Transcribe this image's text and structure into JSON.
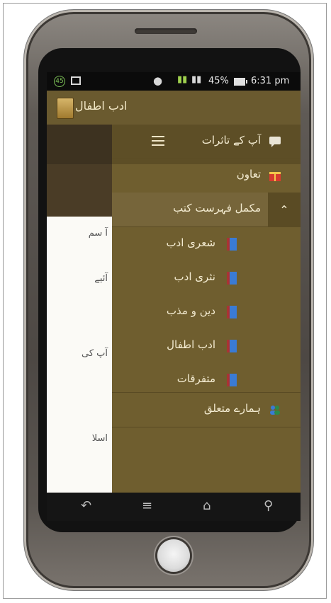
{
  "status_bar": {
    "badge": "45",
    "battery_pct": "45%",
    "time": "6:31 pm"
  },
  "app_bar": {
    "title": "ادب اطفال"
  },
  "behind_list": [
    "آ سم",
    "آئیے",
    "آپ کی",
    "اسلا"
  ],
  "drawer": {
    "items": [
      {
        "label": "آپ کے تاثرات",
        "icon": "comment-icon"
      },
      {
        "label": "تعاون",
        "icon": "gift-icon"
      },
      {
        "label": "مکمل فہرست کتب",
        "icon": "clipboard-icon"
      },
      {
        "label": "ہمارے متعلق",
        "icon": "people-icon"
      }
    ],
    "sub_items": [
      {
        "label": "شعری ادب",
        "icon": "book-icon"
      },
      {
        "label": "نثری ادب",
        "icon": "book-icon"
      },
      {
        "label": "دین و مذب",
        "icon": "book-icon"
      },
      {
        "label": "ادب اطفال",
        "icon": "book-icon"
      },
      {
        "label": "متفرقات",
        "icon": "book-icon"
      }
    ]
  },
  "nav_bar": {
    "back": "back-icon",
    "menu": "menu-icon",
    "home": "home-icon",
    "search": "search-icon"
  },
  "colors": {
    "drawer_bg": "#6f5e2f",
    "action_bar": "#6a5a2f",
    "text_light": "#f4ecd2"
  }
}
